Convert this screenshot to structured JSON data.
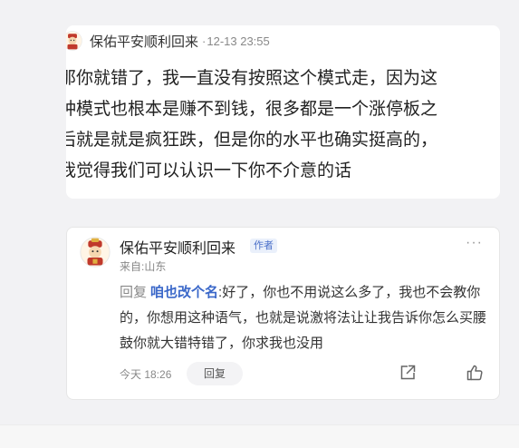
{
  "post": {
    "author": "保佑平安顺利回来",
    "separator": "·",
    "time": "12-13 23:55",
    "lines": [
      "那你就错了，我一直没有按照这个模式走，因为这",
      "种模式也根本是赚不到钱，很多都是一个涨停板之",
      "后就是就是疯狂跌，但是你的水平也确实挺高的，",
      "我觉得我们可以认识一下你不介意的话"
    ]
  },
  "comment": {
    "author": "保佑平安顺利回来",
    "badge": "作者",
    "more": "···",
    "location": "来自:山东",
    "reply_label": "回复",
    "reply_target": "咱也改个名",
    "reply_colon": ":",
    "reply_text": "好了，你也不用说这么多了，我也不会教你的，你想用这种语气，也就是说激将法让让我告诉你怎么买腰鼓你就大错特错了，你求我也没用",
    "time": "今天 18:26",
    "reply_button": "回复"
  },
  "icons": {
    "avatar": "avatar-icon",
    "share": "share-icon",
    "like": "thumbs-up-icon"
  }
}
